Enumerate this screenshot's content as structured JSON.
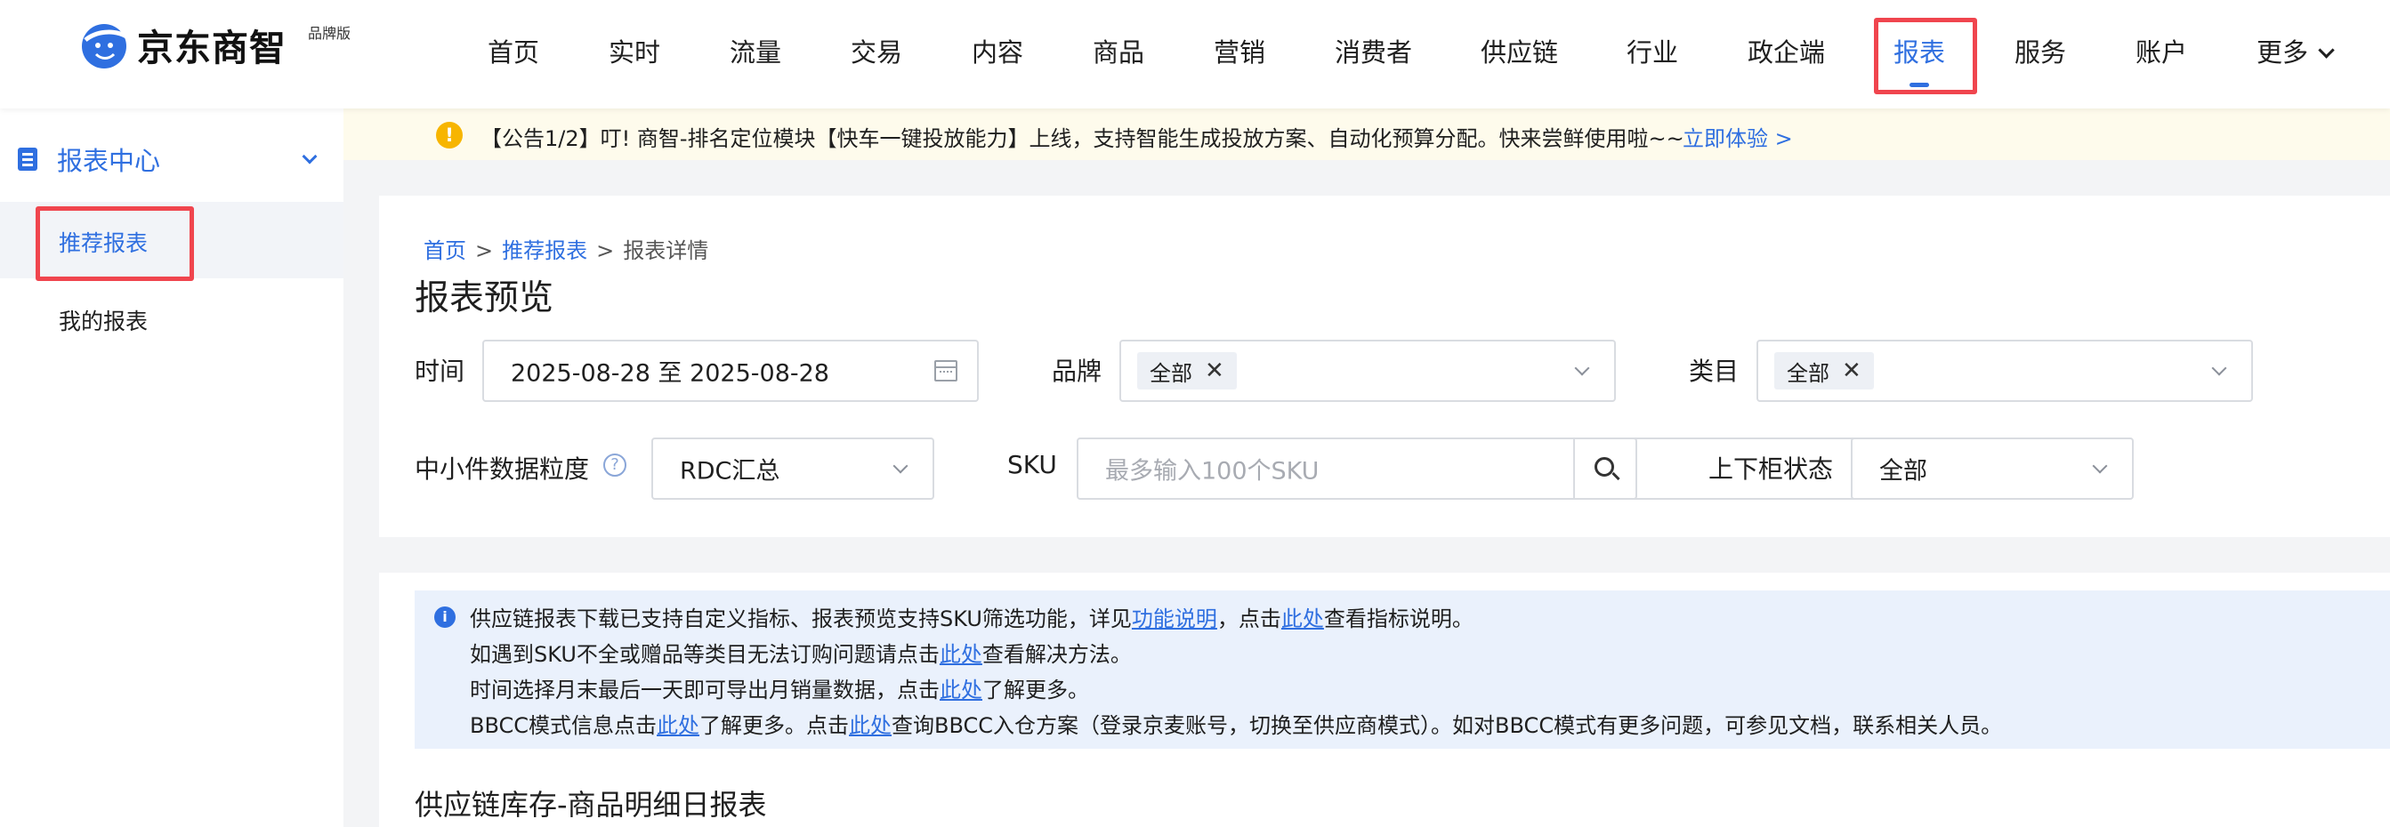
{
  "header": {
    "logo_text": "京东商智",
    "logo_sub": "品牌版",
    "nav": [
      "首页",
      "实时",
      "流量",
      "交易",
      "内容",
      "商品",
      "营销",
      "消费者",
      "供应链",
      "行业",
      "政企端",
      "报表",
      "服务",
      "账户",
      "更多"
    ],
    "active_nav": "报表"
  },
  "sidebar": {
    "title": "报表中心",
    "items": [
      "推荐报表",
      "我的报表"
    ]
  },
  "notice": {
    "text": "【公告1/2】叮! 商智-排名定位模块【快车一键投放能力】上线，支持智能生成投放方案、自动化预算分配。快来尝鲜使用啦~~",
    "link": "立即体验 >"
  },
  "breadcrumb": {
    "home": "首页",
    "sep1": ">",
    "parent": "推荐报表",
    "sep2": ">",
    "current": "报表详情"
  },
  "page_title": "报表预览",
  "filters": {
    "time_label": "时间",
    "time_value": "2025-08-28 至 2025-08-28",
    "brand_label": "品牌",
    "brand_tag": "全部",
    "category_label": "类目",
    "category_tag": "全部",
    "granularity_label": "中小件数据粒度",
    "granularity_value": "RDC汇总",
    "sku_label": "SKU",
    "sku_placeholder": "最多输入100个SKU",
    "shelf_label": "上下柜状态",
    "shelf_value": "全部"
  },
  "info": {
    "l1_a": "供应链报表下载已支持自定义指标、报表预览支持SKU筛选功能，详见",
    "l1_link1": "功能说明",
    "l1_b": "，点击",
    "l1_link2": "此处",
    "l1_c": "查看指标说明。",
    "l2_a": "如遇到SKU不全或赠品等类目无法订购问题请点击",
    "l2_link": "此处",
    "l2_b": "查看解决方法。",
    "l3_a": "时间选择月末最后一天即可导出月销量数据，点击",
    "l3_link": "此处",
    "l3_b": "了解更多。",
    "l4_a": "BBCC模式信息点击",
    "l4_link1": "此处",
    "l4_b": "了解更多。点击",
    "l4_link2": "此处",
    "l4_c": "查询BBCC入仓方案（登录京麦账号，切换至供应商模式）。如对BBCC模式有更多问题，可参见文档，联系相关人员。"
  },
  "report_title": "供应链库存-商品明细日报表",
  "colors": {
    "accent": "#2f6fe0",
    "highlight": "#f0454e",
    "notice_bg": "#fefbec",
    "info_bg": "#eaf1fc"
  }
}
